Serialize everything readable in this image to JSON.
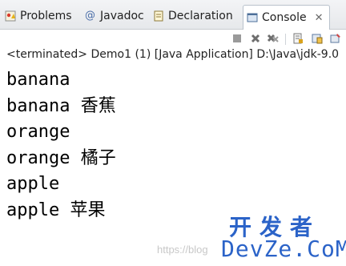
{
  "tabs": [
    {
      "label": "Problems",
      "icon": "problems-icon",
      "active": false
    },
    {
      "label": "Javadoc",
      "icon": "javadoc-at-icon",
      "active": false
    },
    {
      "label": "Declaration",
      "icon": "declaration-icon",
      "active": false
    },
    {
      "label": "Console",
      "icon": "console-icon",
      "active": true
    }
  ],
  "tab_close_glyph": "✕",
  "toolbar_icons": [
    "terminate-icon",
    "remove-launch-icon",
    "remove-all-terminated-icon",
    "scroll-lock-icon",
    "show-console-icon",
    "pin-console-icon"
  ],
  "status_line": "<terminated> Demo1 (1) [Java Application] D:\\Java\\jdk-9.0",
  "console_lines": [
    {
      "en": "banana",
      "zh": ""
    },
    {
      "en": "banana",
      "zh": "香蕉"
    },
    {
      "en": "orange",
      "zh": ""
    },
    {
      "en": "orange",
      "zh": "橘子"
    },
    {
      "en": "apple",
      "zh": ""
    },
    {
      "en": "apple",
      "zh": "苹果"
    }
  ],
  "watermark": {
    "faint_text": "https://blog",
    "brand_top": "开发者",
    "brand_bottom": "DevZe.CoM"
  },
  "colors": {
    "watermark_blue": "#2b63c8",
    "active_tab_border": "#b9c2cc"
  }
}
